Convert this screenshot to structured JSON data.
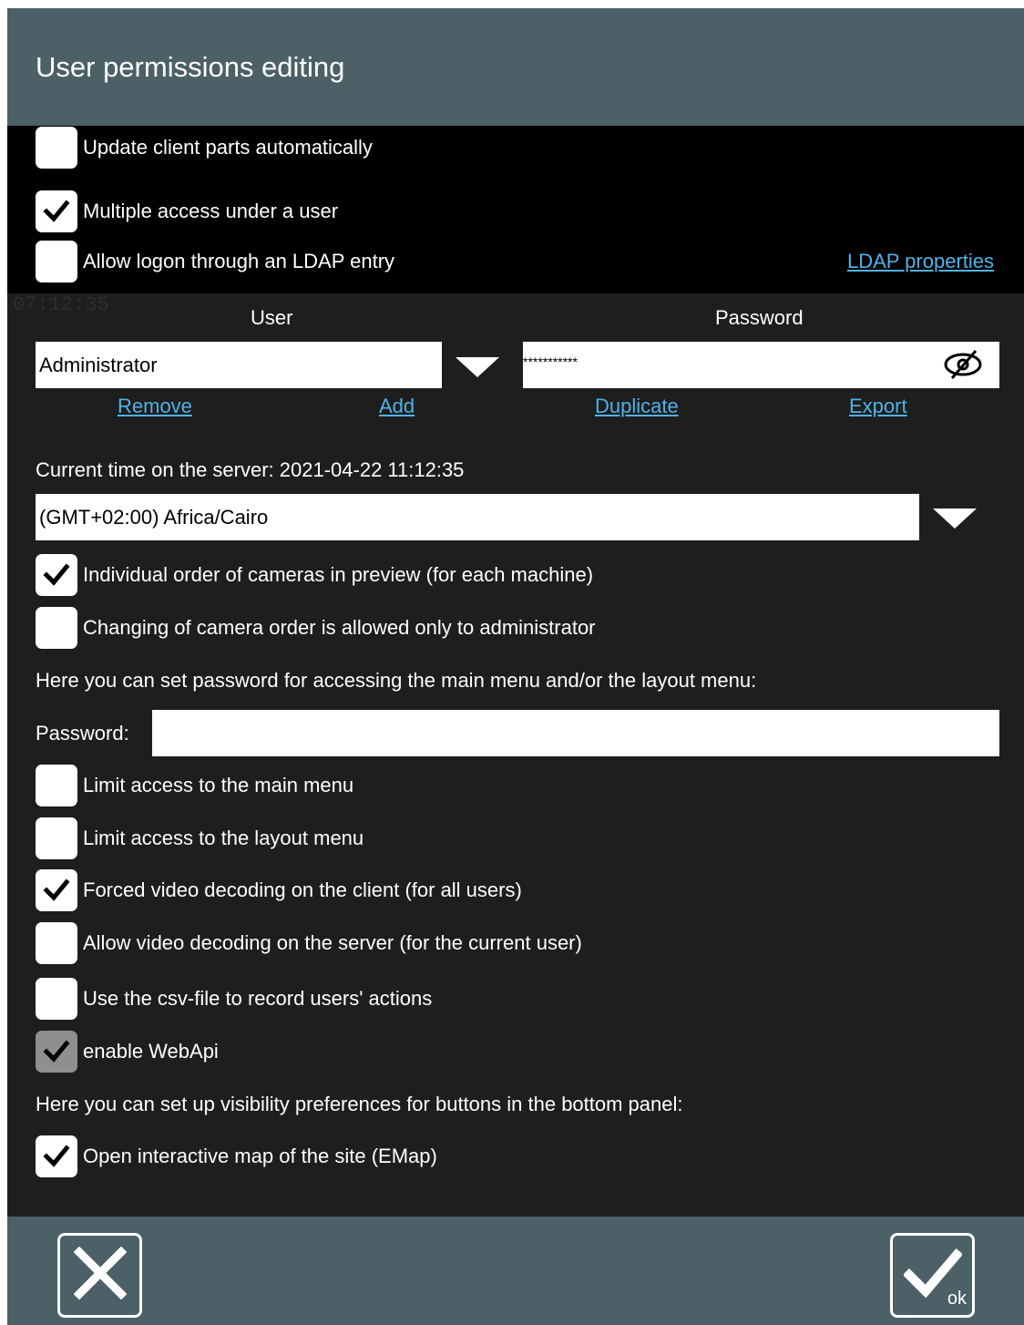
{
  "dialog": {
    "title": "User permissions editing"
  },
  "background": {
    "clock": "07:12:35"
  },
  "options_top": [
    {
      "label": "Update client parts automatically",
      "checked": false
    },
    {
      "label": "Multiple access under a user",
      "checked": true
    },
    {
      "label": "Allow logon through an LDAP entry",
      "checked": false
    }
  ],
  "ldap_properties_link": "LDAP properties",
  "user_section": {
    "user_header": "User",
    "password_header": "Password",
    "user_value": "Administrator",
    "password_value": "***********",
    "actions": {
      "remove": "Remove",
      "add": "Add",
      "duplicate": "Duplicate",
      "export": "Export"
    }
  },
  "server_time": "Current time on the server: 2021-04-22 11:12:35",
  "timezone": {
    "selected": "(GMT+02:00) Africa/Cairo"
  },
  "options_camera": [
    {
      "label": "Individual order of cameras in preview (for each machine)",
      "checked": true
    },
    {
      "label": "Changing of camera order is allowed only to administrator",
      "checked": false
    }
  ],
  "menu_password": {
    "hint": "Here you can set password for accessing the main menu and/or the layout menu:",
    "label": "Password:",
    "value": ""
  },
  "options_access": [
    {
      "label": "Limit access to the main menu",
      "checked": false
    },
    {
      "label": "Limit access to the layout menu",
      "checked": false
    },
    {
      "label": "Forced video decoding on the client (for all users)",
      "checked": true
    },
    {
      "label": "Allow video decoding on the server (for the current user)",
      "checked": false
    },
    {
      "label": "Use the csv-file to record users' actions",
      "checked": false
    },
    {
      "label": "enable WebApi",
      "checked": true,
      "disabled": true
    }
  ],
  "visibility_hint": "Here you can set up visibility preferences for buttons in the bottom panel:",
  "options_panel": [
    {
      "label": "Open interactive map of the site (EMap)",
      "checked": true
    }
  ],
  "footer": {
    "ok_label": "ok"
  },
  "icons": {
    "check": "check-icon",
    "cancel": "close-icon",
    "ok": "check-icon",
    "eye": "eye-off-icon",
    "dropdown": "dropdown-arrow-icon"
  },
  "colors": {
    "title_bar": "#4b6067",
    "panel_bg": "#1e1e1e",
    "link": "#4fb3e6"
  }
}
